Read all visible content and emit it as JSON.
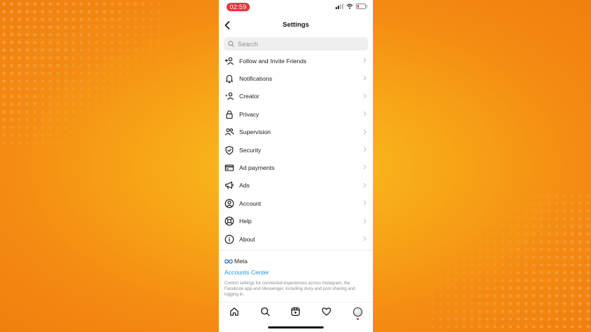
{
  "status_bar": {
    "time": "02:59"
  },
  "header": {
    "title": "Settings"
  },
  "search": {
    "placeholder": "Search"
  },
  "menu": {
    "items": [
      {
        "label": "Follow and Invite Friends",
        "icon": "add-person-icon"
      },
      {
        "label": "Notifications",
        "icon": "bell-icon"
      },
      {
        "label": "Creator",
        "icon": "creator-icon"
      },
      {
        "label": "Privacy",
        "icon": "lock-icon"
      },
      {
        "label": "Supervision",
        "icon": "people-icon"
      },
      {
        "label": "Security",
        "icon": "shield-icon"
      },
      {
        "label": "Ad payments",
        "icon": "credit-card-icon"
      },
      {
        "label": "Ads",
        "icon": "megaphone-icon"
      },
      {
        "label": "Account",
        "icon": "user-circle-icon"
      },
      {
        "label": "Help",
        "icon": "lifebuoy-icon"
      },
      {
        "label": "About",
        "icon": "info-icon"
      }
    ]
  },
  "meta": {
    "logo_text": "Meta",
    "accounts_center": "Accounts Center",
    "description": "Control settings for connected experiences across Instagram, the Facebook app and Messenger, including story and post sharing and logging in."
  },
  "tabbar": {
    "icons": [
      "home-icon",
      "search-icon",
      "reels-icon",
      "heart-icon",
      "profile-avatar"
    ]
  },
  "colors": {
    "accent_link": "#1f93e8",
    "time_pill": "#e8333e",
    "background_orange": "#f7a617"
  }
}
